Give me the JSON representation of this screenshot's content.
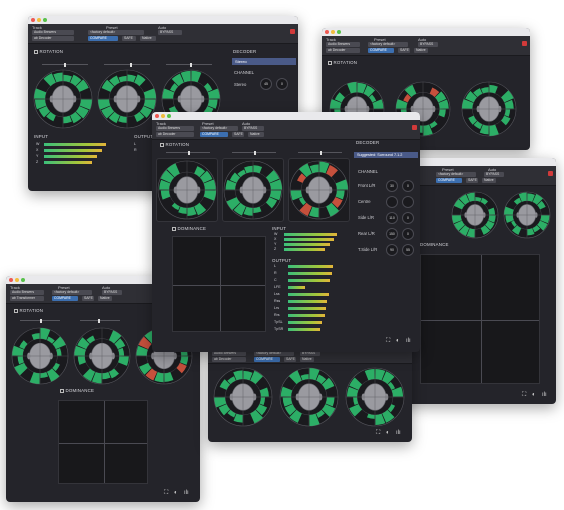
{
  "header": {
    "track_label": "Track",
    "preset_label": "Preset",
    "auto_label": "Auto",
    "track_value": "Audio Brewers",
    "preset_value": "<factory default>",
    "bypass_label": "BYPASS",
    "plugin_name": "ab Decoder",
    "plugin_name_alt": "ab Transformer",
    "compare_label": "COMPARE",
    "safe_label": "SAFE",
    "native_label": "Native"
  },
  "sections": {
    "rotation": "ROTATION",
    "decoder": "DECODER",
    "dominance": "DOMINANCE",
    "input": "INPUT",
    "output": "OUTPUT"
  },
  "decoder_back": {
    "format": "Stereo",
    "channel_label": "CHANNEL",
    "row_label": "Stereo",
    "dial1": "45",
    "dial2": "0"
  },
  "decoder_main": {
    "format": "Suggested: Surround 7.1.2",
    "channel_label": "CHANNEL",
    "rows": [
      {
        "label": "Front L/R",
        "d1": "30",
        "d2": "0"
      },
      {
        "label": "Centre",
        "d1": "",
        "d2": ""
      },
      {
        "label": "Side L/R",
        "d1": "110",
        "d2": "0"
      },
      {
        "label": "Rear L/R",
        "d1": "150",
        "d2": "0"
      },
      {
        "label": "T.Side L/R",
        "d1": "90",
        "d2": "55"
      }
    ]
  },
  "inputs": {
    "labels": [
      "W",
      "X",
      "Y",
      "Z"
    ],
    "levels": [
      0.86,
      0.8,
      0.74,
      0.66
    ]
  },
  "outputs_back": {
    "labels": [
      "L",
      "R"
    ],
    "levels": [
      0.7,
      0.65
    ]
  },
  "outputs_main": {
    "labels": [
      "L",
      "R",
      "C",
      "LFE",
      "Lss",
      "Rss",
      "Lrs",
      "Rrs",
      "TpSL",
      "TpSR"
    ],
    "levels": [
      0.78,
      0.76,
      0.72,
      0.3,
      0.7,
      0.68,
      0.66,
      0.64,
      0.58,
      0.56
    ]
  },
  "colors": {
    "window_bg": "#24242a",
    "accent_green": "#2fbf6e",
    "accent_blue": "#3c6fb0",
    "bypass_red": "#d23a3a"
  },
  "icons": [
    "close-icon",
    "fullscreen-icon",
    "contrast-icon",
    "logo-icon",
    "checkbox-icon"
  ]
}
